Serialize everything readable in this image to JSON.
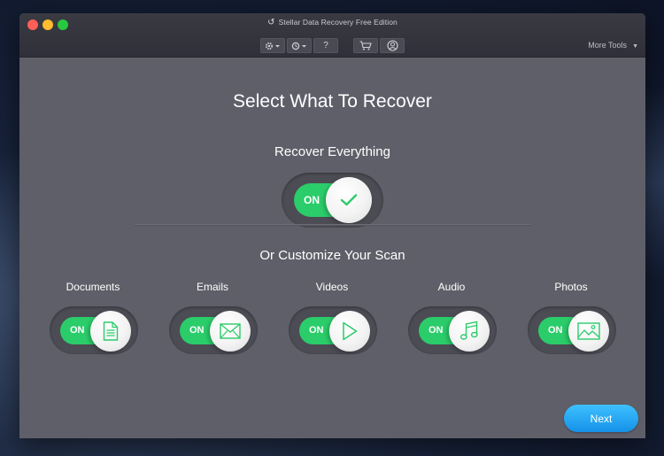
{
  "window": {
    "title": "Stellar Data Recovery Free Edition",
    "more_tools": "More Tools"
  },
  "toolbar": {
    "items": [
      {
        "icon": "gear-icon"
      },
      {
        "icon": "history-icon"
      },
      {
        "icon": "help-icon",
        "label": "?"
      },
      {
        "icon": "cart-icon"
      },
      {
        "icon": "account-icon"
      }
    ]
  },
  "main": {
    "heading": "Select What To Recover",
    "recover_everything": {
      "label": "Recover Everything",
      "state": "ON"
    },
    "customize_heading": "Or Customize Your Scan",
    "categories": [
      {
        "label": "Documents",
        "state": "ON",
        "icon": "document-icon"
      },
      {
        "label": "Emails",
        "state": "ON",
        "icon": "envelope-icon"
      },
      {
        "label": "Videos",
        "state": "ON",
        "icon": "play-icon"
      },
      {
        "label": "Audio",
        "state": "ON",
        "icon": "music-note-icon"
      },
      {
        "label": "Photos",
        "state": "ON",
        "icon": "image-icon"
      }
    ],
    "next_label": "Next"
  },
  "colors": {
    "toggle_on": "#2bcc6a",
    "accent_button": "#1da1f2",
    "window_bg": "#5f5f69"
  }
}
